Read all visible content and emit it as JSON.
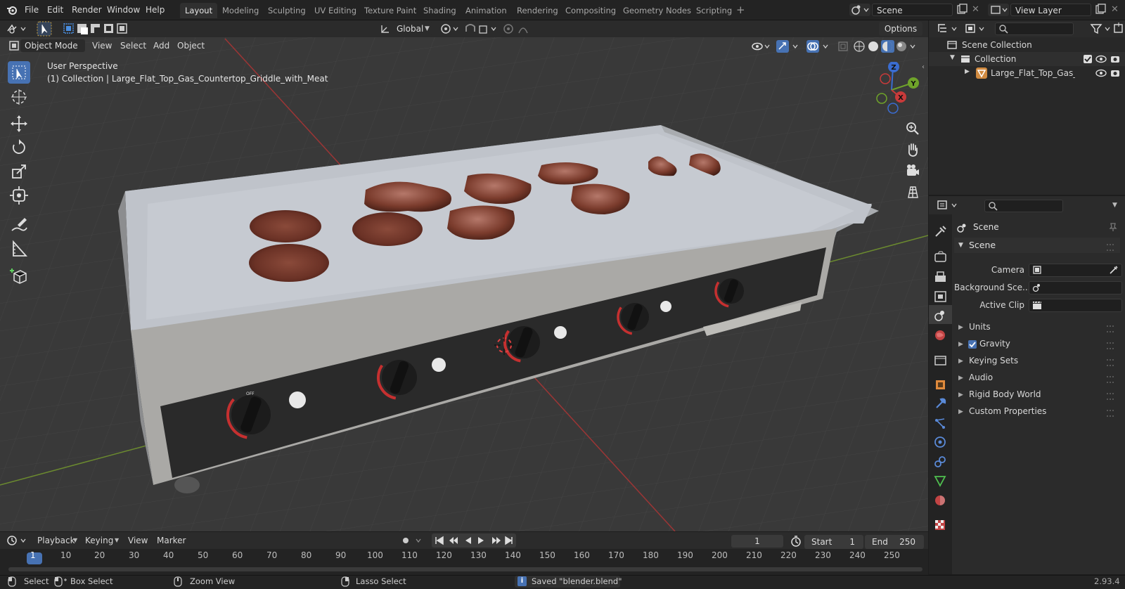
{
  "app": {
    "menu": [
      "File",
      "Edit",
      "Render",
      "Window",
      "Help"
    ],
    "workspaces": [
      "Layout",
      "Modeling",
      "Sculpting",
      "UV Editing",
      "Texture Paint",
      "Shading",
      "Animation",
      "Rendering",
      "Compositing",
      "Geometry Nodes",
      "Scripting"
    ],
    "active_workspace": "Layout",
    "scene_name": "Scene",
    "view_layer": "View Layer"
  },
  "viewport": {
    "transform_orientation": "Global",
    "options_label": "Options",
    "mode": "Object Mode",
    "menus": [
      "View",
      "Select",
      "Add",
      "Object"
    ],
    "overlay_title": "User Perspective",
    "overlay_subtitle": "(1) Collection | Large_Flat_Top_Gas_Countertop_Griddle_with_Meat",
    "gizmo_axes": {
      "x": "X",
      "y": "Y",
      "z": "Z"
    },
    "dial_label": "OFF",
    "colors": {
      "background": "#393939",
      "grid": "#444444",
      "x_axis": "#9c3535",
      "y_axis": "#6b8a2f",
      "active_tool": "#4772b3"
    }
  },
  "timeline": {
    "menus": [
      "Playback",
      "Keying",
      "View",
      "Marker"
    ],
    "current_frame": "1",
    "start_label": "Start",
    "start": "1",
    "end_label": "End",
    "end": "250",
    "ruler": [
      "1",
      "10",
      "20",
      "30",
      "40",
      "50",
      "60",
      "70",
      "80",
      "90",
      "100",
      "110",
      "120",
      "130",
      "140",
      "150",
      "160",
      "170",
      "180",
      "190",
      "200",
      "210",
      "220",
      "230",
      "240",
      "250"
    ]
  },
  "status": {
    "select": "Select",
    "box_select": "Box Select",
    "zoom_view": "Zoom View",
    "lasso_select": "Lasso Select",
    "message": "Saved \"blender.blend\"",
    "version": "2.93.4"
  },
  "outliner": {
    "scene_collection": "Scene Collection",
    "collection": "Collection",
    "object": "Large_Flat_Top_Gas_Cou"
  },
  "properties": {
    "header": "Scene",
    "panel": "Scene",
    "camera_label": "Camera",
    "background_label": "Background Sce...",
    "active_clip_label": "Active Clip",
    "sections": [
      "Units",
      "Gravity",
      "Keying Sets",
      "Audio",
      "Rigid Body World",
      "Custom Properties"
    ],
    "gravity_checked": true
  }
}
